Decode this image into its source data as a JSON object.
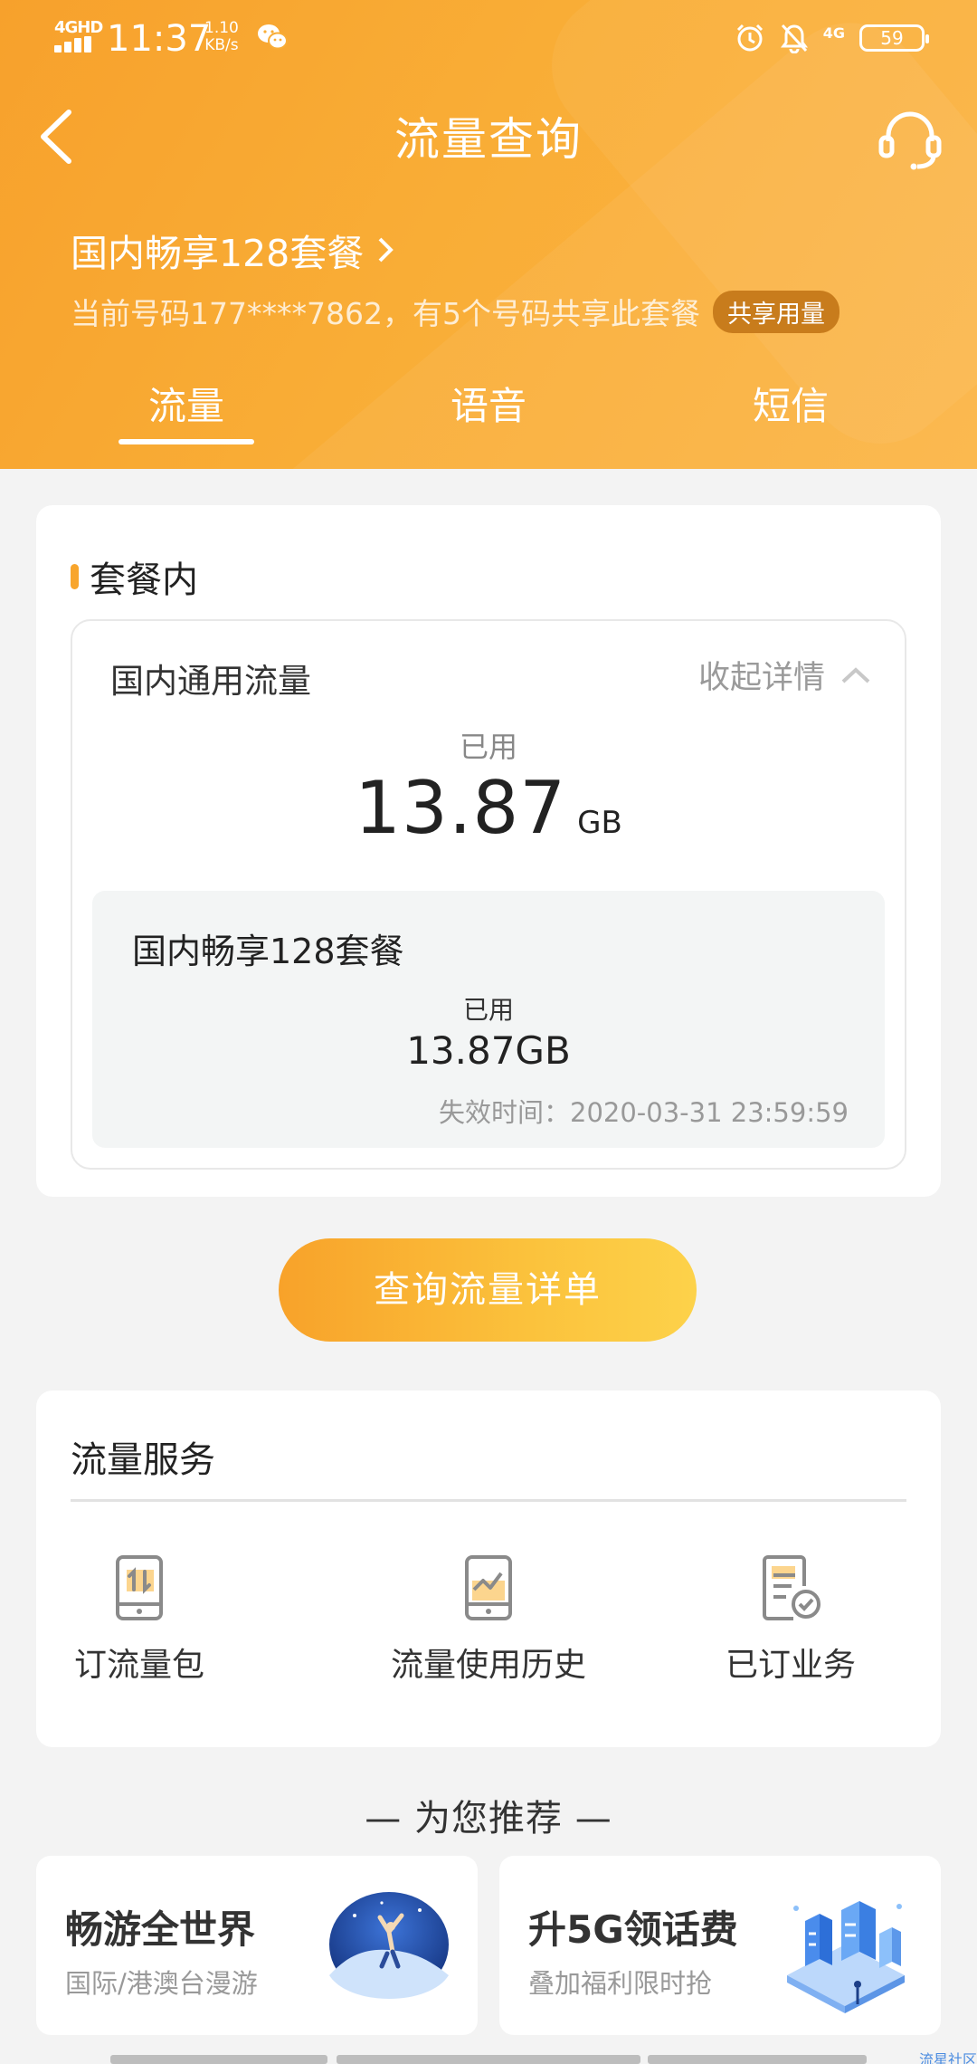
{
  "status_bar": {
    "network_type": "4GHD",
    "time": "11:37",
    "speed_value": "1.10",
    "speed_unit": "KB/s",
    "net_right": "4G",
    "battery": "59"
  },
  "nav": {
    "title": "流量查询"
  },
  "plan": {
    "name": "国内畅享128套餐",
    "desc": "当前号码177****7862，有5个号码共享此套餐",
    "share_badge": "共享用量"
  },
  "tabs": [
    "流量",
    "语音",
    "短信"
  ],
  "package_section": {
    "title": "套餐内",
    "domestic_label": "国内通用流量",
    "collapse_label": "收起详情",
    "used_label": "已用",
    "used_value": "13.87",
    "used_unit": "GB",
    "sub_package": {
      "name": "国内畅享128套餐",
      "used_label": "已用",
      "used_value": "13.87GB",
      "expiry": "失效时间：2020-03-31 23:59:59"
    }
  },
  "query_button": "查询流量详单",
  "services": {
    "title": "流量服务",
    "items": [
      {
        "label": "订流量包",
        "icon": "phone-transfer-icon"
      },
      {
        "label": "流量使用历史",
        "icon": "phone-chart-icon"
      },
      {
        "label": "已订业务",
        "icon": "document-check-icon"
      }
    ]
  },
  "recommend": {
    "title": "— 为您推荐 —",
    "cards": [
      {
        "title": "畅游全世界",
        "subtitle": "国际/港澳台漫游"
      },
      {
        "title": "升5G领话费",
        "subtitle": "叠加福利限时抢"
      }
    ]
  },
  "watermark": "流星社区",
  "colors": {
    "header_orange": "#f9ad36",
    "accent_orange": "#f8a52c",
    "badge_brown": "#c87c1c",
    "background": "#f3f3f3"
  }
}
